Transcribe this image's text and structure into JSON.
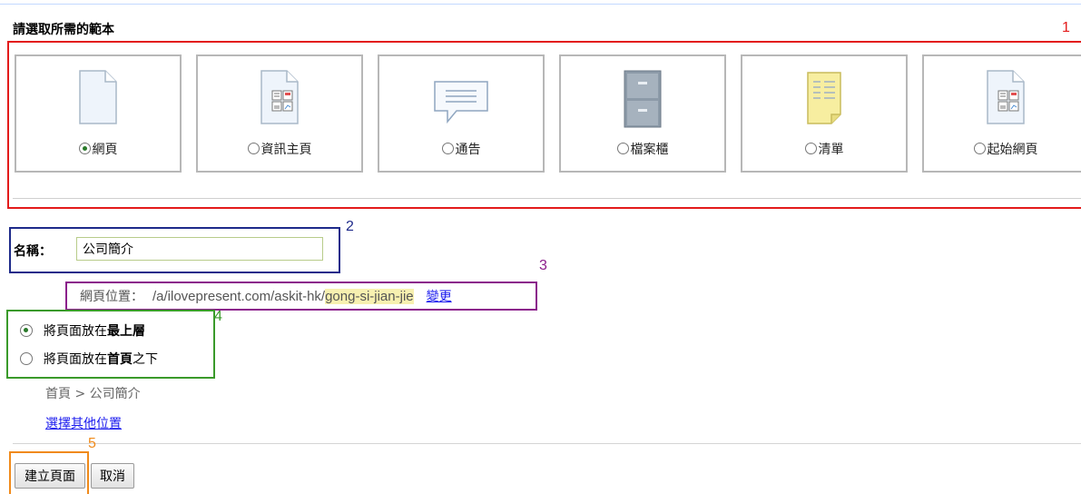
{
  "heading": "請選取所需的範本",
  "annotations": {
    "a1": "1",
    "a2": "2",
    "a3": "3",
    "a4": "4",
    "a5": "5"
  },
  "templates": [
    {
      "label": "網頁",
      "icon": "blank-page-icon",
      "selected": true
    },
    {
      "label": "資訊主頁",
      "icon": "dashboard-page-icon",
      "selected": false
    },
    {
      "label": "通告",
      "icon": "speech-bubble-icon",
      "selected": false
    },
    {
      "label": "檔案櫃",
      "icon": "file-cabinet-icon",
      "selected": false
    },
    {
      "label": "清單",
      "icon": "notepad-list-icon",
      "selected": false
    },
    {
      "label": "起始網頁",
      "icon": "start-page-icon",
      "selected": false
    }
  ],
  "name_field": {
    "label": "名稱：",
    "value": "公司簡介"
  },
  "page_location": {
    "label": "網頁位置：",
    "url_prefix": "/a/ilovepresent.com/askit-hk/",
    "url_slug": "gong-si-jian-jie",
    "change_link": "變更"
  },
  "placement": {
    "top_prefix": "將頁面放在",
    "top_bold": "最上層",
    "home_prefix": "將頁面放在",
    "home_bold": "首頁",
    "home_suffix": "之下",
    "selected": "top"
  },
  "breadcrumb": "首頁 > 公司簡介",
  "other_location_link": "選擇其他位置",
  "buttons": {
    "create": "建立頁面",
    "cancel": "取消"
  },
  "colors": {
    "annotation_1": "#e31b1b",
    "annotation_2": "#1e2a8a",
    "annotation_3": "#8b1d8b",
    "annotation_4": "#3a9a2a",
    "annotation_5": "#f08a1a",
    "link": "#1a1aee"
  }
}
